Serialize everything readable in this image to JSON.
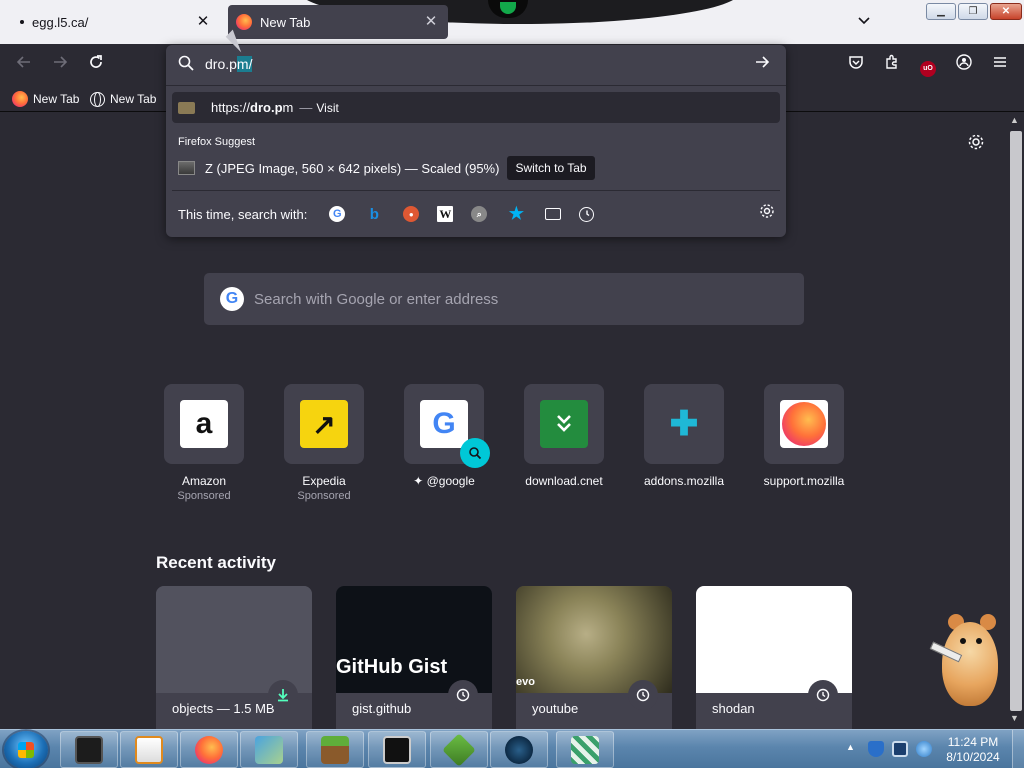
{
  "browser": {
    "tabs": [
      {
        "label": "egg.l5.ca/",
        "active": false
      },
      {
        "label": "New Tab",
        "active": true
      }
    ],
    "close_glyph": "✕",
    "nav_icons": [
      "arrow-left-icon",
      "arrow-right-icon",
      "reload-icon"
    ],
    "toolbar_icons": [
      "pocket-icon",
      "extensions-icon",
      "ublock-origin-icon",
      "account-icon",
      "hamburger-menu-icon"
    ],
    "ublock_badge": "uO",
    "bookmarks": [
      {
        "label": "New Tab",
        "icon": "firefox-icon"
      },
      {
        "label": "New Tab",
        "icon": "globe-icon"
      }
    ]
  },
  "urlbar": {
    "typed": "dro.p",
    "autofill": "m/",
    "results": {
      "visit": {
        "prefix": "https://",
        "bold": "dro.p",
        "suffix": "m",
        "separator": "—",
        "action": "Visit"
      },
      "suggest_heading": "Firefox Suggest",
      "switch_tab": {
        "title": "Z (JPEG Image, 560 × 642 pixels) — Scaled (95%)",
        "action": "Switch to Tab"
      }
    },
    "oneoff_label": "This time, search with:",
    "engines": [
      "Google",
      "Bing",
      "DuckDuckGo",
      "Wikipedia",
      "Search",
      "Bookmarks",
      "Tabs",
      "History"
    ]
  },
  "newtab": {
    "search_placeholder": "Search with Google or enter address",
    "top_sites": [
      {
        "label": "Amazon",
        "sponsored": "Sponsored",
        "glyph": "a"
      },
      {
        "label": "Expedia",
        "sponsored": "Sponsored",
        "glyph": "↗"
      },
      {
        "label": "@google",
        "sponsored": "",
        "glyph": "G"
      },
      {
        "label": "download.cnet",
        "sponsored": "",
        "glyph": "»"
      },
      {
        "label": "addons.mozilla",
        "sponsored": "",
        "glyph": "✚"
      },
      {
        "label": "support.mozilla",
        "sponsored": "",
        "glyph": ""
      }
    ],
    "google_prefix": "✦",
    "recent_heading": "Recent activity",
    "recent": [
      {
        "label": "objects — 1.5 MB",
        "badge_icon": "download-icon"
      },
      {
        "label": "gist.github",
        "badge_icon": "history-icon",
        "thumb_text": "GitHub Gist"
      },
      {
        "label": "youtube",
        "badge_icon": "history-icon",
        "thumb_text": "evo"
      },
      {
        "label": "shodan",
        "badge_icon": "history-icon"
      }
    ]
  },
  "taskbar": {
    "time": "11:24 PM",
    "date": "8/10/2024"
  }
}
